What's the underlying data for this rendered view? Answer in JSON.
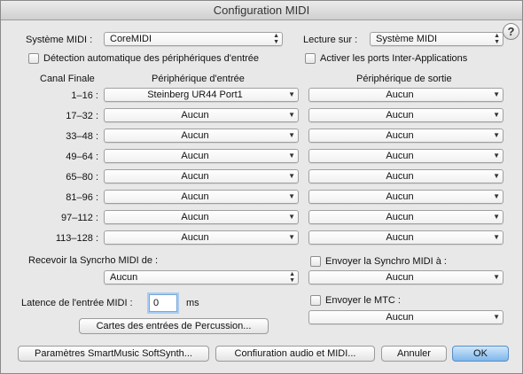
{
  "window": {
    "title": "Configuration MIDI"
  },
  "help_glyph": "?",
  "systeme_midi": {
    "label": "Système MIDI :",
    "value": "CoreMIDI"
  },
  "lecture_sur": {
    "label": "Lecture sur :",
    "value": "Système MIDI"
  },
  "detection_auto": {
    "label": "Détection automatique des périphériques d'entrée",
    "checked": false
  },
  "inter_apps": {
    "label": "Activer les ports Inter-Applications",
    "checked": false
  },
  "headers": {
    "canal": "Canal Finale",
    "entree": "Périphérique d'entrée",
    "sortie": "Périphérique de sortie"
  },
  "rows": [
    {
      "canal": "1–16 :",
      "entree": "Steinberg UR44 Port1",
      "sortie": "Aucun"
    },
    {
      "canal": "17–32 :",
      "entree": "Aucun",
      "sortie": "Aucun"
    },
    {
      "canal": "33–48 :",
      "entree": "Aucun",
      "sortie": "Aucun"
    },
    {
      "canal": "49–64 :",
      "entree": "Aucun",
      "sortie": "Aucun"
    },
    {
      "canal": "65–80 :",
      "entree": "Aucun",
      "sortie": "Aucun"
    },
    {
      "canal": "81–96 :",
      "entree": "Aucun",
      "sortie": "Aucun"
    },
    {
      "canal": "97–112 :",
      "entree": "Aucun",
      "sortie": "Aucun"
    },
    {
      "canal": "113–128 :",
      "entree": "Aucun",
      "sortie": "Aucun"
    }
  ],
  "recevoir_sync": {
    "label": "Recevoir la Syncrho MIDI de :",
    "value": "Aucun"
  },
  "envoyer_sync": {
    "label": "Envoyer la Synchro MIDI à :",
    "value": "Aucun",
    "checked": false
  },
  "latence": {
    "label": "Latence de l'entrée MIDI :",
    "value": "0",
    "unit": "ms"
  },
  "envoyer_mtc": {
    "label": "Envoyer le MTC :",
    "value": "Aucun",
    "checked": false
  },
  "buttons": {
    "percussion": "Cartes des entrées de Percussion...",
    "smartmusic": "Paramètres SmartMusic SoftSynth...",
    "config_audio": "Confiuration audio et MIDI...",
    "annuler": "Annuler",
    "ok": "OK"
  },
  "icons": {
    "popup_arrow": "chevron-down-icon",
    "stepper_arrows": "updown-arrows-icon"
  },
  "colors": {
    "default_button": "#7fb6ea",
    "focus_ring": "#a9cdf2"
  }
}
